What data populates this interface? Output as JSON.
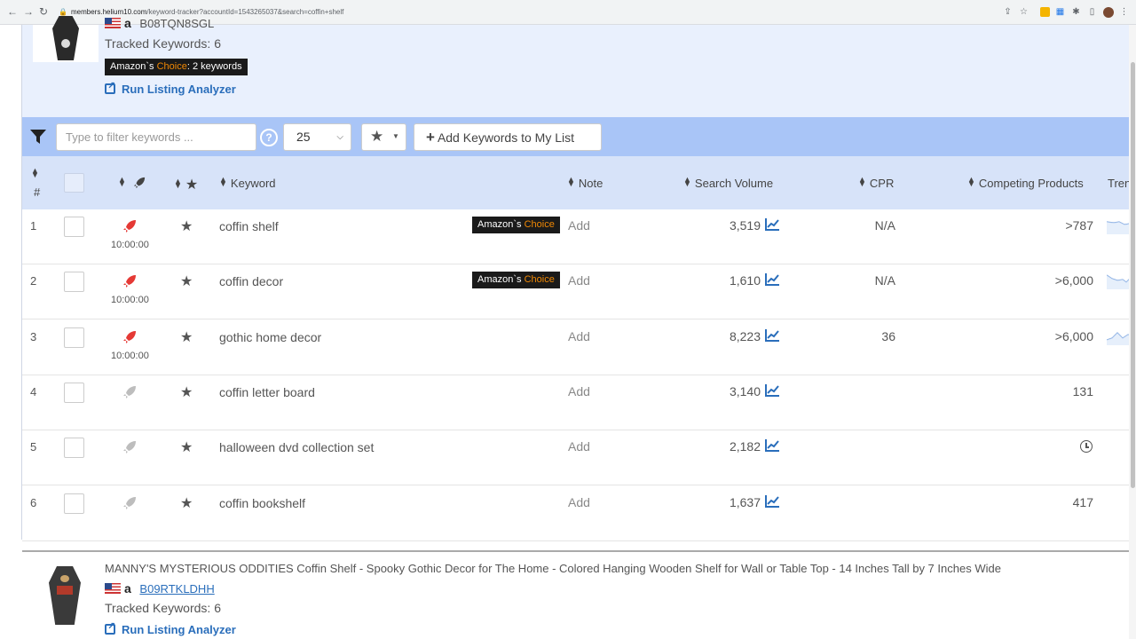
{
  "browser": {
    "url_host": "members.helium10.com",
    "url_path": "/keyword-tracker?accountId=1543265037&search=coffin+shelf"
  },
  "top_product": {
    "asin": "B08TQN8SGL",
    "tracked_keywords": "Tracked Keywords: 6",
    "amazon_choice_prefix": "Amazon`s ",
    "amazon_choice_word": "Choice",
    "amazon_choice_suffix": ": 2 keywords",
    "run_analyzer": "Run Listing Analyzer"
  },
  "toolbar": {
    "filter_placeholder": "Type to filter keywords ...",
    "per_page": "25",
    "add_keywords": "Add Keywords to My List"
  },
  "columns": {
    "num": "#",
    "keyword": "Keyword",
    "note": "Note",
    "search_volume": "Search Volume",
    "cpr": "CPR",
    "competing": "Competing Products",
    "trend": "Trend"
  },
  "badge": {
    "amazon": "Amazon`s ",
    "choice": "Choice"
  },
  "rows": [
    {
      "num": "1",
      "keyword": "coffin shelf",
      "choice": true,
      "rank_time": "10:00:00",
      "ranked": true,
      "note": "Add",
      "volume": "3,519",
      "cpr": "N/A",
      "competing": ">787"
    },
    {
      "num": "2",
      "keyword": "coffin decor",
      "choice": true,
      "rank_time": "10:00:00",
      "ranked": true,
      "note": "Add",
      "volume": "1,610",
      "cpr": "N/A",
      "competing": ">6,000"
    },
    {
      "num": "3",
      "keyword": "gothic home decor",
      "choice": false,
      "rank_time": "10:00:00",
      "ranked": true,
      "note": "Add",
      "volume": "8,223",
      "cpr": "36",
      "competing": ">6,000"
    },
    {
      "num": "4",
      "keyword": "coffin letter board",
      "choice": false,
      "rank_time": "",
      "ranked": false,
      "note": "Add",
      "volume": "3,140",
      "cpr": "",
      "competing": "131"
    },
    {
      "num": "5",
      "keyword": "halloween dvd collection set",
      "choice": false,
      "rank_time": "",
      "ranked": false,
      "note": "Add",
      "volume": "2,182",
      "cpr": "",
      "competing": ""
    },
    {
      "num": "6",
      "keyword": "coffin bookshelf",
      "choice": false,
      "rank_time": "",
      "ranked": false,
      "note": "Add",
      "volume": "1,637",
      "cpr": "",
      "competing": "417"
    }
  ],
  "second_product": {
    "title": "MANNY'S MYSTERIOUS ODDITIES Coffin Shelf - Spooky Gothic Decor for The Home - Colored Hanging Wooden Shelf for Wall or Table Top - 14 Inches Tall by 7 Inches Wide",
    "asin": "B09RTKLDHH",
    "tracked_keywords": "Tracked Keywords: 6",
    "run_analyzer": "Run Listing Analyzer"
  },
  "colors": {
    "accent_blue": "#2a6ebb",
    "toolbar_bg": "#a9c5f7",
    "header_bg": "#d7e3f9",
    "rocket_active": "#e53935",
    "rocket_inactive": "#bdbdbd"
  }
}
